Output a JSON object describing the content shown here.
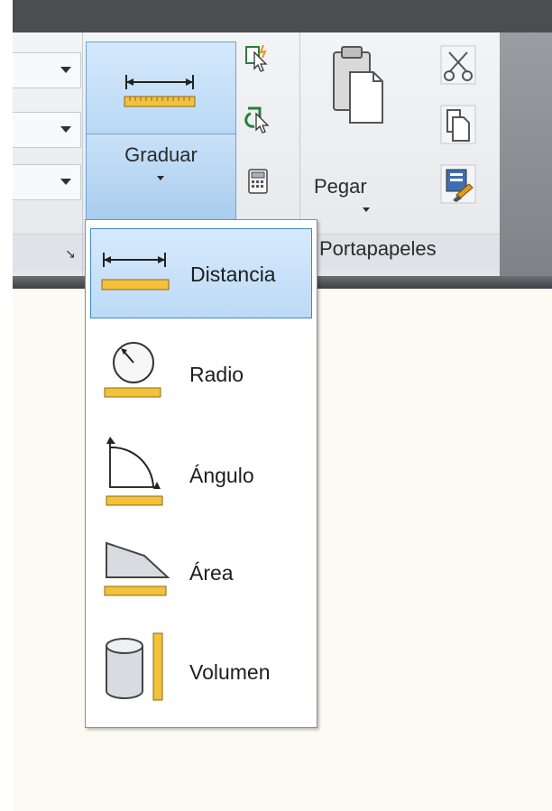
{
  "ribbon": {
    "graduar": {
      "label": "Graduar"
    },
    "pegar": {
      "label": "Pegar"
    },
    "panels": {
      "portapapeles": "Portapapeles"
    },
    "launcher_glyph": "↘"
  },
  "menu": {
    "items": [
      {
        "label": "Distancia",
        "icon": "distance-measure-icon",
        "selected": true
      },
      {
        "label": "Radio",
        "icon": "radius-measure-icon",
        "selected": false
      },
      {
        "label": "Ángulo",
        "icon": "angle-measure-icon",
        "selected": false
      },
      {
        "label": "Área",
        "icon": "area-measure-icon",
        "selected": false
      },
      {
        "label": "Volumen",
        "icon": "volume-measure-icon",
        "selected": false
      }
    ]
  },
  "colors": {
    "titlebar": "#4b4d50",
    "selection": "#bcdaf6",
    "ruler": "#f3c13a",
    "canvas": "#fcfaf3"
  }
}
